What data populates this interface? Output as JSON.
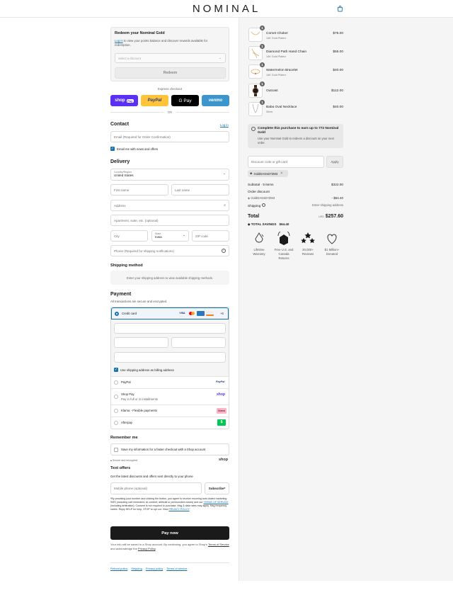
{
  "header": {
    "logo": "NOMINAL"
  },
  "redeem": {
    "title": "Redeem your Nominal Gold",
    "desc_link": "Log in",
    "desc": " to view your points balance and discover rewards available for redemption.",
    "select_placeholder": "Select a discount",
    "button": "Redeem"
  },
  "express": {
    "label": "Express checkout",
    "shop": "shop",
    "shop_pay": "Pay",
    "paypal": "PayPal",
    "gpay": "G Pay",
    "venmo": "venmo",
    "or": "OR"
  },
  "contact": {
    "title": "Contact",
    "login": "Log in",
    "email_placeholder": "Email (Required for Order Confirmation)",
    "news": "Email me with news and offers"
  },
  "delivery": {
    "title": "Delivery",
    "country_label": "Country/Region",
    "country": "United States",
    "first": "First name",
    "last": "Last name",
    "address": "Address",
    "apt": "Apartment, suite, etc. (optional)",
    "city": "City",
    "state_label": "State",
    "state": "Iowa",
    "zip": "ZIP code",
    "phone": "Phone (Required for shipping notifications)"
  },
  "shipping": {
    "title": "Shipping method",
    "note": "Enter your shipping address to view available shipping methods."
  },
  "payment": {
    "title": "Payment",
    "sub": "All transactions are secure and encrypted.",
    "credit": "Credit card",
    "more": "+6",
    "billing": "Use shipping address as billing address",
    "paypal": "PayPal",
    "paypal_logo": "PayPal",
    "shoppay": "Shop Pay",
    "shoppay_sub": "Pay in full or in installments",
    "shoppay_logo": "shop",
    "klarna": "Klarna - Flexible payments",
    "klarna_logo": "Klarna",
    "afterpay": "Afterpay",
    "afterpay_logo": "$"
  },
  "remember": {
    "title": "Remember me",
    "save": "Save my information for a faster checkout with a Shop account",
    "secure": "Secure and encrypted",
    "shop": "shop"
  },
  "text_offers": {
    "title": "Text offers",
    "sub": "Get the latest discounts and offers sent directly to your phone",
    "phone_placeholder": "Mobile phone (optional)",
    "subscribe": "Subscribe*",
    "legal1": "*By providing your number and clicking the button, you agree to receive recurring auto-dialed marketing SMS (including cart reminders; AI content; artificial or prerecorded voices) and our ",
    "terms": "TERMS OF SERVICE",
    "legal2": " (including arbitration). Consent is not required to purchase. Msg & data rates may apply. Msg frequency varies. Reply HELP for help, STOP to opt out. View ",
    "privacy": "PRIVACY POLICY",
    "legal3": "."
  },
  "pay": {
    "button": "Pay now",
    "note1": "Your info will be saved to a Shop account. By continuing, you agree to Shop's ",
    "tos": "Terms of Service",
    "note2": " and acknowledge the ",
    "pp": "Privacy Policy",
    "note3": "."
  },
  "footer": {
    "links": [
      "Refund policy",
      "Shipping",
      "Privacy policy",
      "Terms of service"
    ]
  },
  "cart": {
    "items": [
      {
        "qty": "1",
        "name": "Comet Choker",
        "sub": "14K Gold Plated",
        "price": "$75.00"
      },
      {
        "qty": "1",
        "name": "Diamond Path Hand Chain",
        "sub": "14K Gold Plated",
        "price": "$55.00"
      },
      {
        "qty": "1",
        "name": "Watermelon Bracelet",
        "sub": "14K Gold Plated",
        "price": "$40.00"
      },
      {
        "qty": "1",
        "name": "Outcast",
        "sub": "",
        "price": "$112.00"
      },
      {
        "qty": "1",
        "name": "Baba Oval Necklace",
        "sub": "Silver",
        "price": "$40.00"
      }
    ],
    "promo_title": "Complete this purchase to earn up to 772 Nominal Gold",
    "promo_sub": "Use your Nominal Gold to redeem a discount on your next order.",
    "discount_placeholder": "Discount code or gift card",
    "apply": "Apply",
    "code": "GoldDAGsD7ZM3",
    "subtotal_label": "Subtotal · 5 items",
    "subtotal": "$322.00",
    "order_discount": "Order discount",
    "code_line": "GoldDAGsD7ZM3",
    "discount_amount": "- $64.40",
    "shipping_label": "Shipping",
    "shipping_value": "Enter shipping address",
    "total_label": "Total",
    "currency": "USD",
    "total": "$257.60",
    "savings_label": "TOTAL SAVINGS",
    "savings": "$64.40",
    "badges": [
      {
        "icon": "diamond-drop-icon",
        "line1": "Lifetime",
        "line2": "Warranty",
        "line3": ""
      },
      {
        "icon": "return-box-icon",
        "line1": "Free U.S. and",
        "line2": "Canada",
        "line3": "Returns"
      },
      {
        "icon": "stars-icon",
        "line1": "20,000+",
        "line2": "Reviews",
        "line3": ""
      },
      {
        "icon": "heart-icon",
        "line1": "$1 Million+",
        "line2": "Donated",
        "line3": ""
      }
    ]
  }
}
